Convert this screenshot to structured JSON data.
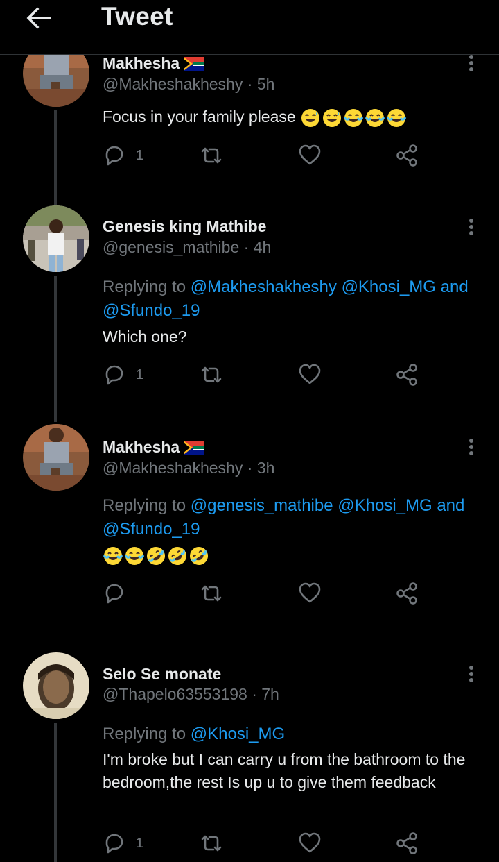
{
  "header": {
    "title": "Tweet"
  },
  "tweets": [
    {
      "name": "Makhesha",
      "handle": "@Makheshakheshy",
      "time": "5h",
      "text": "Focus in your family please",
      "replying_label": "",
      "mentions": [],
      "and_label": "",
      "emojis": [
        "sweat-smile",
        "sweat-smile",
        "joy",
        "joy",
        "joy"
      ],
      "reply_count": "1"
    },
    {
      "name": "Genesis king Mathibe",
      "handle": "@genesis_mathibe",
      "time": "4h",
      "replying_label": "Replying to",
      "mentions": [
        "@Makheshakheshy",
        "@Khosi_MG",
        "@Sfundo_19"
      ],
      "and_label": "and",
      "text": "Which one?",
      "emojis": [],
      "reply_count": "1"
    },
    {
      "name": "Makhesha",
      "handle": "@Makheshakheshy",
      "time": "3h",
      "replying_label": "Replying to",
      "mentions": [
        "@genesis_mathibe",
        "@Khosi_MG",
        "@Sfundo_19"
      ],
      "and_label": "and",
      "text": "",
      "emojis": [
        "joy",
        "joy",
        "rofl",
        "rofl",
        "rofl"
      ],
      "reply_count": ""
    },
    {
      "name": "Selo Se monate",
      "handle": "@Thapelo63553198",
      "time": "7h",
      "replying_label": "Replying to",
      "mentions": [
        "@Khosi_MG"
      ],
      "and_label": "",
      "text": "I'm broke but I can carry u from the bathroom to the bedroom,the rest Is up u to give them feedback",
      "emojis": [],
      "reply_count": "1"
    }
  ],
  "separator": "·",
  "colors": {
    "background": "#000000",
    "text": "#e7e9ea",
    "muted": "#71767b",
    "link": "#1d9bf0",
    "divider": "#2f3336"
  }
}
